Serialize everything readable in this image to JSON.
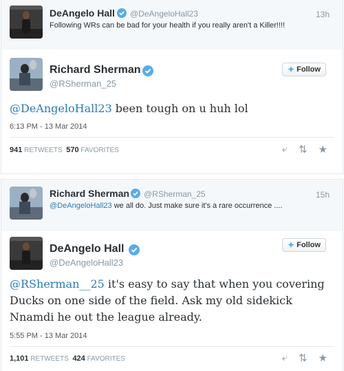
{
  "embed1": {
    "parent": {
      "name": "DeAngelo Hall",
      "handle": "@DeAngeloHall23",
      "time": "13h",
      "text": "Following WRs can be bad for your health if you really aren't a Killer!!!!"
    },
    "main": {
      "name": "Richard Sherman",
      "handle": "@RSherman_25",
      "follow_label": "Follow",
      "mention": "@DeAngeloHall23",
      "text": " been tough on u huh lol",
      "timestamp": "6:13 PM - 13 Mar 2014",
      "retweets_count": "941",
      "retweets_label": "RETWEETS",
      "favorites_count": "570",
      "favorites_label": "FAVORITES"
    }
  },
  "embed2": {
    "parent": {
      "name": "Richard Sherman",
      "handle": "@RSherman_25",
      "time": "15h",
      "mention": "@DeAngeloHall23",
      "text": " we all do.  Just make sure it's a rare occurrence ...."
    },
    "main": {
      "name": "DeAngelo Hall",
      "handle": "@DeAngeloHall23",
      "follow_label": "Follow",
      "mention": "@RSherman__25",
      "text_line1": " it's easy to say that when you covering",
      "text_line2": "Ducks on one side of the field. Ask my old sidekick",
      "text_line3": "Nnamdi he out the league already.",
      "timestamp": "5:55 PM - 13 Mar 2014",
      "retweets_count": "1,101",
      "retweets_label": "RETWEETS",
      "favorites_count": "424",
      "favorites_label": "FAVORITES"
    }
  },
  "icons": {
    "verified": "verified-badge-icon",
    "bird": "twitter-bird-icon",
    "reply": "reply-icon",
    "retweet": "retweet-icon",
    "favorite": "star-icon"
  },
  "colors": {
    "link": "#2b7bb9",
    "verified": "#55acee",
    "muted": "#8899a6"
  }
}
